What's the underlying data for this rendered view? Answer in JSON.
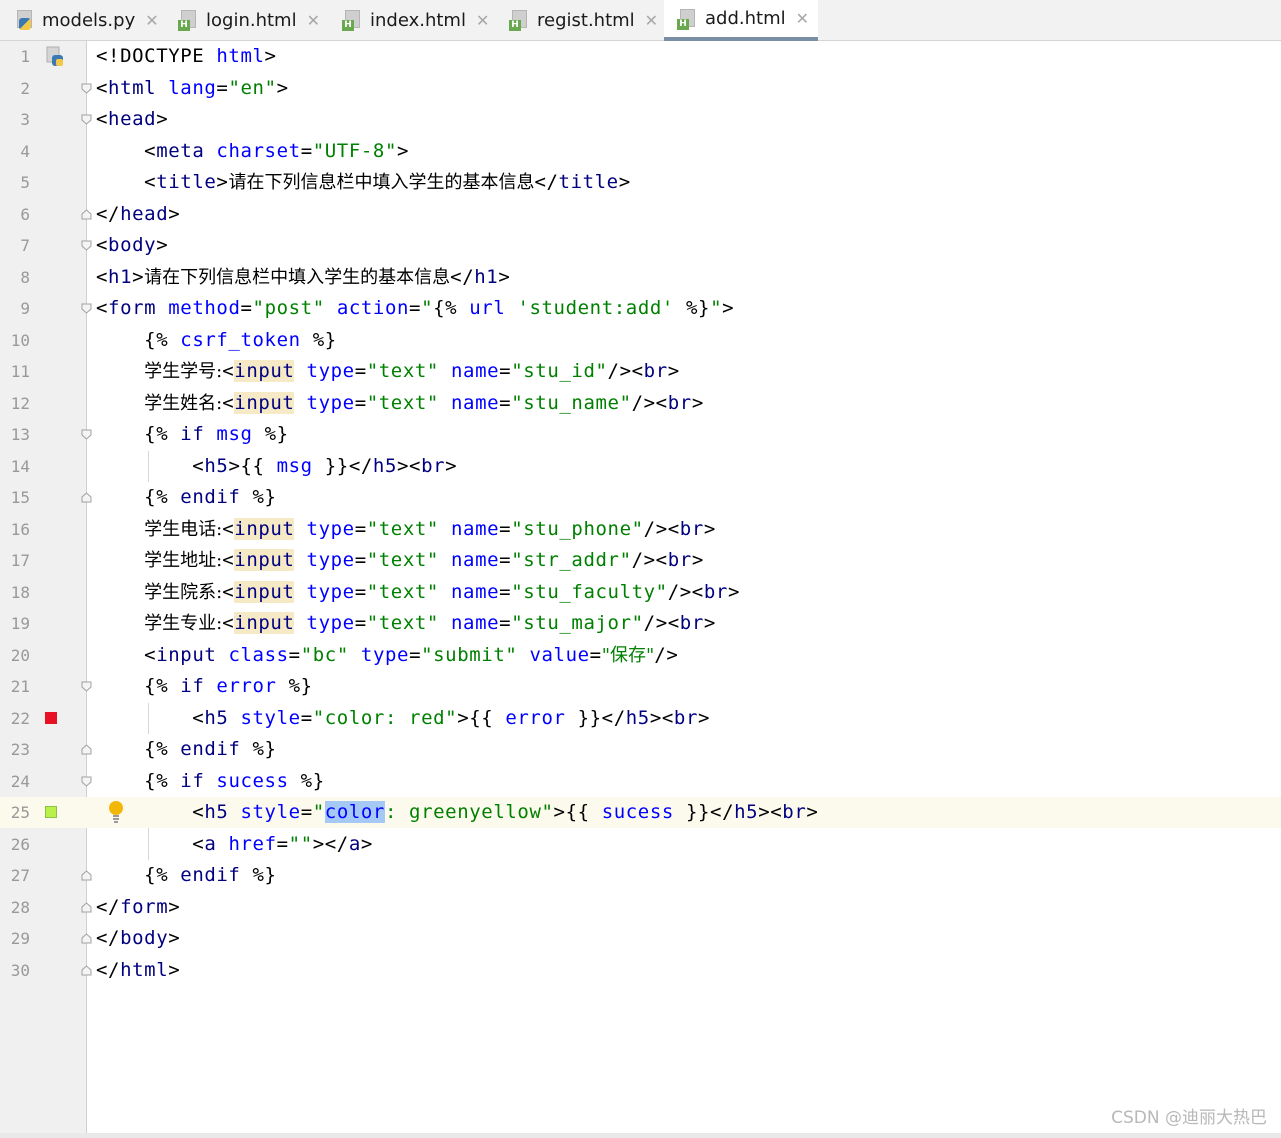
{
  "tabs": [
    {
      "label": "models.py",
      "icon": "python-file-icon"
    },
    {
      "label": "login.html",
      "icon": "html-file-icon"
    },
    {
      "label": "index.html",
      "icon": "html-file-icon"
    },
    {
      "label": "regist.html",
      "icon": "html-file-icon"
    },
    {
      "label": "add.html",
      "icon": "html-file-icon",
      "active": true
    }
  ],
  "line_numbers": [
    "1",
    "2",
    "3",
    "4",
    "5",
    "6",
    "7",
    "8",
    "9",
    "10",
    "11",
    "12",
    "13",
    "14",
    "15",
    "16",
    "17",
    "18",
    "19",
    "20",
    "21",
    "22",
    "23",
    "24",
    "25",
    "26",
    "27",
    "28",
    "29",
    "30"
  ],
  "code": {
    "l5_title_text": "请在下列信息栏中填入学生的基本信息",
    "l8_h1_text": "请在下列信息栏中填入学生的基本信息",
    "l9_action": "\"{% url 'student:add' %}\"",
    "l11_label": "学生学号:",
    "l11_name": "\"stu_id\"",
    "l12_label": "学生姓名:",
    "l12_name": "\"stu_name\"",
    "l16_label": "学生电话:",
    "l16_name": "\"stu_phone\"",
    "l17_label": "学生地址:",
    "l17_name": "\"str_addr\"",
    "l18_label": "学生院系:",
    "l18_name": "\"stu_faculty\"",
    "l19_label": "学生专业:",
    "l19_name": "\"stu_major\"",
    "l20_value": "\"保存\"",
    "l22_style": "\"color: red\"",
    "l25_style_value": ": greenyellow\""
  },
  "colors": {
    "tag": "#000080",
    "attribute": "#0000ff",
    "string": "#008000",
    "error_marker": "#e81123",
    "color_marker": "#b9f04a",
    "selection": "#a6c8f5",
    "caret_line": "#fcfaed"
  },
  "watermark": "CSDN @迪丽大热巴"
}
